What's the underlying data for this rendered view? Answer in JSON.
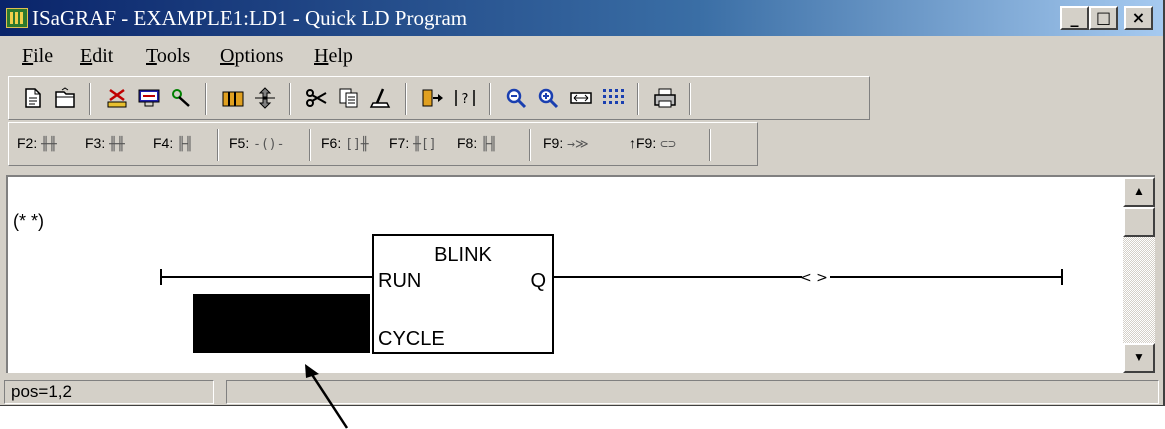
{
  "window": {
    "title": "ISaGRAF - EXAMPLE1:LD1 - Quick LD Program",
    "caption_buttons": {
      "minimize": "_",
      "maximize": "□",
      "close": "×"
    }
  },
  "menu": [
    {
      "u": "F",
      "rest": "ile"
    },
    {
      "u": "E",
      "rest": "dit"
    },
    {
      "u": "T",
      "rest": "ools"
    },
    {
      "u": "O",
      "rest": "ptions"
    },
    {
      "u": "H",
      "rest": "elp"
    }
  ],
  "toolbar": {
    "icons": [
      "new-document-icon",
      "open-document-icon",
      "cut-red-icon",
      "comment-box-icon",
      "tool-icon",
      "block-library-icon",
      "arrows-icon",
      "scissors-icon",
      "copy-icon",
      "clean-icon",
      "jump-icon",
      "variable-icon",
      "zoom-out-icon",
      "zoom-in-icon",
      "fit-icon",
      "grid-icon",
      "print-icon"
    ]
  },
  "ld_toolbar": {
    "f2": {
      "key": "F2:",
      "glyph": "╫╫"
    },
    "f3": {
      "key": "F3:",
      "glyph": "╫╫"
    },
    "f4": {
      "key": "F4:",
      "glyph": "╟╢"
    },
    "f5": {
      "key": "F5:",
      "glyph": "-()-"
    },
    "f6": {
      "key": "F6:",
      "glyph": "[]╫"
    },
    "f7": {
      "key": "F7:",
      "glyph": "╫[]"
    },
    "f8": {
      "key": "F8:",
      "glyph": "╟╢"
    },
    "f9": {
      "key": "F9:",
      "glyph": "→≫"
    },
    "sf9": {
      "key": "↑F9:",
      "glyph": "⊂⊃"
    }
  },
  "diagram": {
    "comment": "(* *)",
    "block": {
      "name": "BLINK",
      "input1": "RUN",
      "input2": "CYCLE",
      "output": "Q"
    },
    "coil": "< >"
  },
  "status": {
    "position": "pos=1,2",
    "message": ""
  },
  "scrollbar": {
    "up": "▲",
    "down": "▼"
  }
}
